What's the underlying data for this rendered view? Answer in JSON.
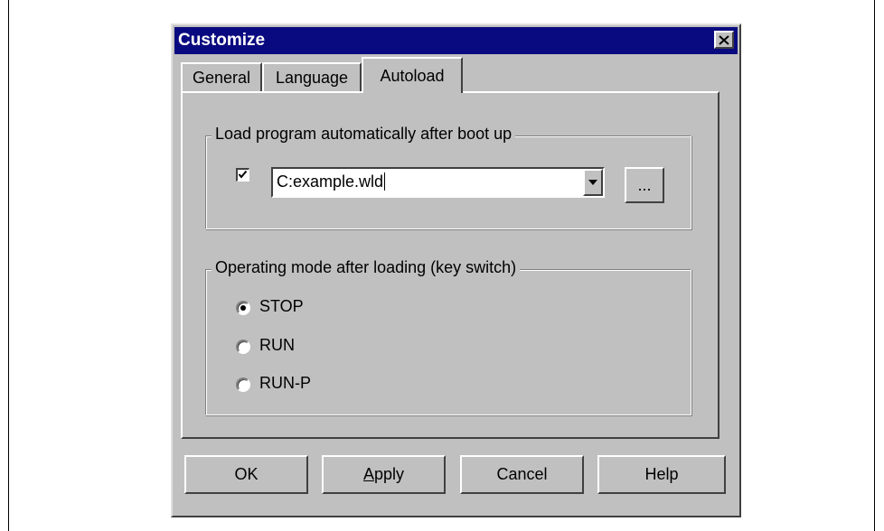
{
  "dialog": {
    "title": "Customize",
    "close_icon": "close-icon"
  },
  "tabs": [
    {
      "label": "General",
      "active": false
    },
    {
      "label": "Language",
      "active": false
    },
    {
      "label": "Autoload",
      "active": true
    }
  ],
  "autoload": {
    "group_label": "Load program automatically after boot up",
    "checked": true,
    "file_value": "C:example.wld",
    "browse_label": "..."
  },
  "mode": {
    "group_label": "Operating mode after loading (key switch)",
    "options": [
      {
        "label": "STOP",
        "selected": true
      },
      {
        "label": "RUN",
        "selected": false
      },
      {
        "label": "RUN-P",
        "selected": false
      }
    ]
  },
  "buttons": {
    "ok": "OK",
    "apply": "Apply",
    "cancel": "Cancel",
    "help": "Help"
  },
  "colors": {
    "titlebar": "#0a0a80",
    "face": "#c0c0c0"
  }
}
